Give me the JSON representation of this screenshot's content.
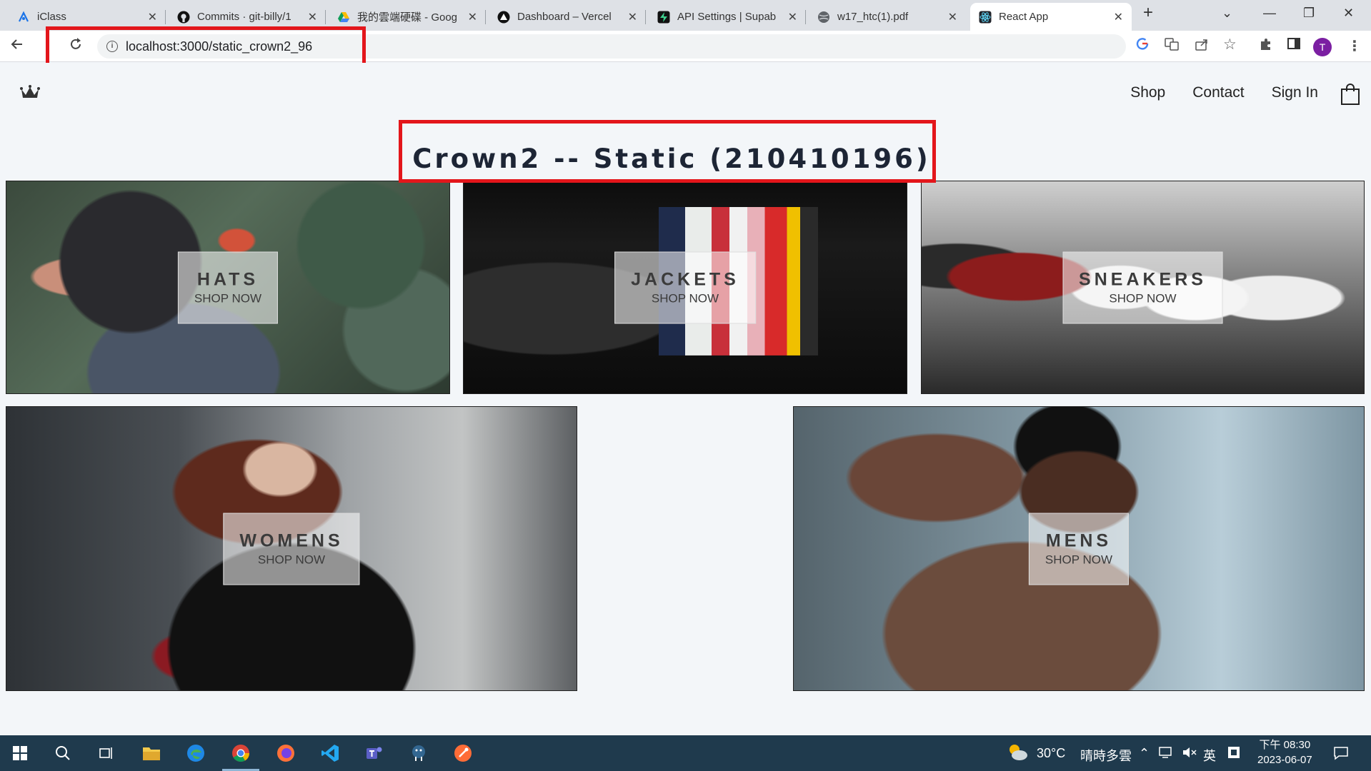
{
  "browser": {
    "tabs": [
      {
        "label": "iClass",
        "icon": "iclass-icon",
        "active": false
      },
      {
        "label": "Commits · git-billy/1",
        "icon": "github-icon",
        "active": false
      },
      {
        "label": "我的雲端硬碟 - Goog",
        "icon": "google-drive-icon",
        "active": false
      },
      {
        "label": "Dashboard – Vercel",
        "icon": "vercel-icon",
        "active": false
      },
      {
        "label": "API Settings | Supab",
        "icon": "supabase-icon",
        "active": false
      },
      {
        "label": "w17_htc(1).pdf",
        "icon": "globe-icon",
        "active": false
      },
      {
        "label": "React App",
        "icon": "react-icon",
        "active": true
      }
    ],
    "url": "localhost:3000/static_crown2_96",
    "profile_initial": "T",
    "highlight_color": "#e3161b"
  },
  "site": {
    "nav": {
      "shop": "Shop",
      "contact": "Contact",
      "sign_in": "Sign In"
    },
    "heading": "Crown2 -- Static (210410196)",
    "categories": [
      {
        "name": "HATS",
        "cta": "SHOP NOW"
      },
      {
        "name": "JACKETS",
        "cta": "SHOP NOW"
      },
      {
        "name": "SNEAKERS",
        "cta": "SHOP NOW"
      },
      {
        "name": "WOMENS",
        "cta": "SHOP NOW"
      },
      {
        "name": "MENS",
        "cta": "SHOP NOW"
      }
    ]
  },
  "taskbar": {
    "weather_temp": "30°C",
    "weather_desc": "晴時多雲",
    "ime": "英",
    "time": "下午 08:30",
    "date": "2023-06-07"
  }
}
